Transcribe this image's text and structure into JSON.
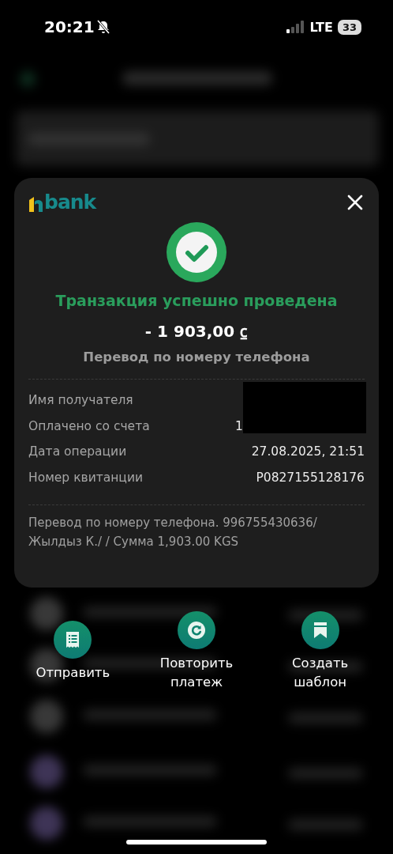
{
  "status_bar": {
    "time": "20:21",
    "silent": true,
    "network": "LTE",
    "battery": "33"
  },
  "receipt": {
    "logo_text": "bank",
    "title": "Транзакция успешно проведена",
    "amount": "- 1 903,00 ⃀",
    "subtitle": "Перевод по номеру телефона",
    "details": [
      {
        "label": "Имя получателя",
        "redacted": true
      },
      {
        "label": "Оплачено со счета",
        "value": "1",
        "redacted": true
      },
      {
        "label": "Дата операции",
        "value": "27.08.2025, 21:51",
        "redacted": false
      },
      {
        "label": "Номер квитанции",
        "value": "P0827155128176",
        "redacted": false
      }
    ],
    "note": "Перевод по номеру телефона. 996755430636/ Жылдыз К./  / Сумма 1,903.00 KGS"
  },
  "actions": [
    {
      "kind": "send",
      "label": "Отправить"
    },
    {
      "kind": "repeat",
      "label": "Повторить платеж"
    },
    {
      "kind": "template",
      "label": "Создать шаблон"
    }
  ]
}
